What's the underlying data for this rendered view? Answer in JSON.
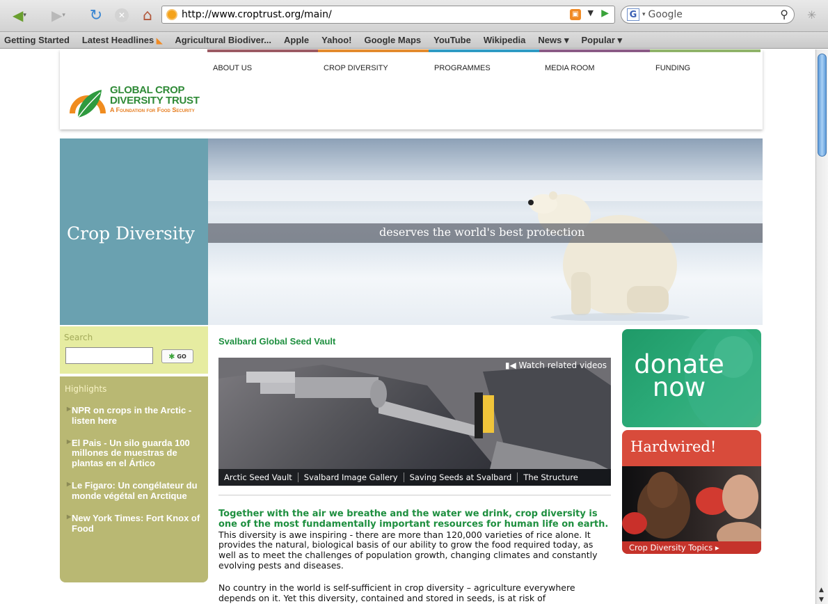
{
  "browser": {
    "url": "http://www.croptrust.org/main/",
    "search_placeholder": "Google",
    "bookmarks": [
      "Getting Started",
      "Latest Headlines",
      "Agricultural Biodiver...",
      "Apple",
      "Yahoo!",
      "Google Maps",
      "YouTube",
      "Wikipedia",
      "News ▾",
      "Popular ▾"
    ]
  },
  "site": {
    "logo": {
      "line1": "GLOBAL CROP",
      "line2": "DIVERSITY TRUST",
      "line3": "A Foundation for Food Security"
    },
    "nav": [
      {
        "label": "ABOUT US",
        "color": "#9c5b64"
      },
      {
        "label": "CROP DIVERSITY",
        "color": "#e38b2e"
      },
      {
        "label": "PROGRAMMES",
        "color": "#2f9bc4"
      },
      {
        "label": "MEDIA ROOM",
        "color": "#8b5b86"
      },
      {
        "label": "FUNDING",
        "color": "#8fb36a"
      }
    ],
    "hero": {
      "left_title": "Crop Diversity",
      "caption": "deserves the world's best protection"
    },
    "search": {
      "label": "Search",
      "button": "GO"
    },
    "highlights": {
      "title": "Highlights",
      "items": [
        "NPR on crops in the Arctic - listen here",
        "El Pais - Un silo guarda 100 millones de muestras de plantas en el Ártico",
        "Le Figaro: Un congélateur du monde végétal en Arctique",
        "New York Times: Fort Knox of Food"
      ]
    },
    "main": {
      "title": "Svalbard Global Seed Vault",
      "watch": "Watch related videos",
      "tabs": [
        "Arctic Seed Vault",
        "Svalbard Image Gallery",
        "Saving Seeds at Svalbard",
        "The Structure"
      ],
      "lead": "Together with the air we breathe and the water we drink, crop diversity is one of the most fundamentally important resources for human life on earth.",
      "para1_rest": " This diversity is awe inspiring - there are more than 120,000 varieties of rice alone. It provides the natural, biological basis of our ability to grow the food required today, as well as to meet the challenges of population growth, changing climates and constantly evolving pests and diseases.",
      "para2": "No country in the world is self-sufficient in crop diversity – agriculture everywhere depends on it. Yet this diversity, contained and stored in seeds, is at risk of"
    },
    "donate": {
      "line1": "donate",
      "line2": "now"
    },
    "hardwired": {
      "title": "Hardwired!",
      "topics": "Crop Diversity Topics ▸"
    }
  }
}
